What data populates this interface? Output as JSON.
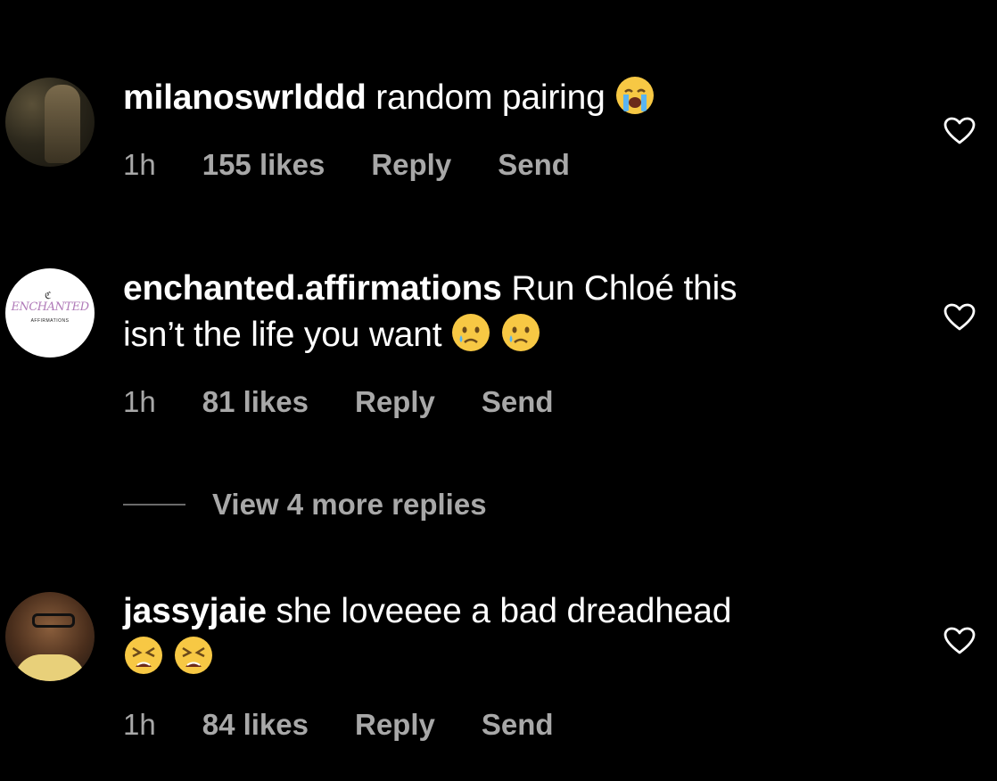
{
  "comments": [
    {
      "username": "milanoswrlddd",
      "text_line1": "random pairing",
      "text_line2": "",
      "emojis": [
        "loudly-crying-face-emoji"
      ],
      "time": "1h",
      "likes": "155 likes",
      "reply_label": "Reply",
      "send_label": "Send"
    },
    {
      "username": "enchanted.affirmations",
      "text_line1": "Run Chloé this",
      "text_line2": "isn’t the life you want",
      "emojis": [
        "crying-face-emoji",
        "crying-face-emoji"
      ],
      "avatar_logo_text": "ENCHANTED",
      "avatar_logo_subtext": "AFFIRMATIONS",
      "time": "1h",
      "likes": "81 likes",
      "reply_label": "Reply",
      "send_label": "Send"
    },
    {
      "username": "jassyjaie",
      "text_line1": "she loveeee a bad dreadhead",
      "text_line2": "",
      "emojis": [
        "tired-face-emoji",
        "tired-face-emoji"
      ],
      "time": "1h",
      "likes": "84 likes",
      "reply_label": "Reply",
      "send_label": "Send"
    }
  ],
  "view_replies_label": "View 4 more replies",
  "colors": {
    "background": "#000000",
    "primary_text": "#ffffff",
    "secondary_text": "#a8a8a8"
  },
  "icons": {
    "like": "heart-outline-icon"
  }
}
